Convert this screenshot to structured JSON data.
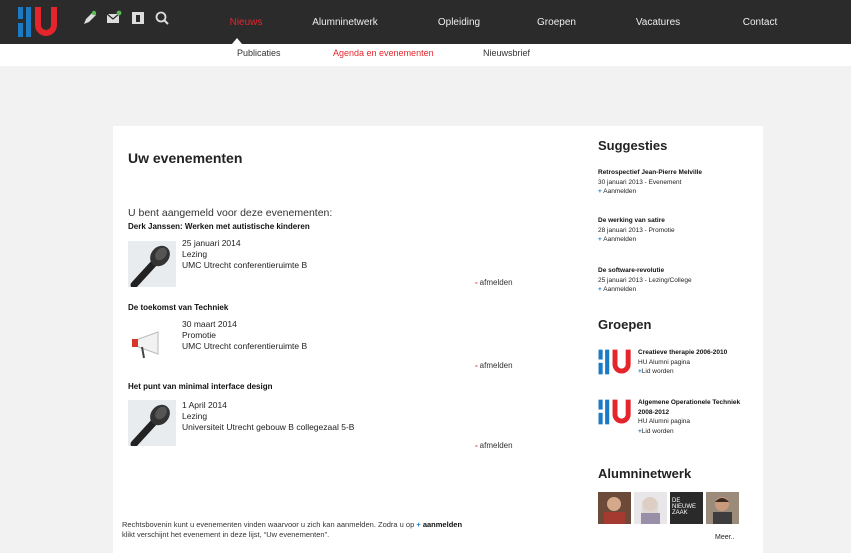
{
  "header": {
    "logo_alt": "HU logo",
    "tools": [
      {
        "icon": "pencil-icon"
      },
      {
        "icon": "mail-icon"
      },
      {
        "icon": "id-card-icon"
      },
      {
        "icon": "search-icon"
      }
    ],
    "nav": [
      {
        "label": "Nieuws",
        "active": true
      },
      {
        "label": "Alumninetwerk",
        "active": false
      },
      {
        "label": "Opleiding",
        "active": false
      },
      {
        "label": "Groepen",
        "active": false
      },
      {
        "label": "Vacatures",
        "active": false
      },
      {
        "label": "Contact",
        "active": false
      }
    ],
    "subnav": [
      {
        "label": "Publicaties",
        "active": false
      },
      {
        "label": "Agenda en evenementen",
        "active": true
      },
      {
        "label": "Nieuwsbrief",
        "active": false
      }
    ]
  },
  "main": {
    "title": "Uw evenementen",
    "intro": "U bent aangemeld voor deze evenementen:",
    "events": [
      {
        "title": "Derk Janssen: Werken met autistische kinderen",
        "date": "25 januari 2014",
        "type": "Lezing",
        "location": "UMC Utrecht conferentieruimte B",
        "action": "afmelden",
        "thumb": "microphone"
      },
      {
        "title": "De toekomst van Techniek",
        "date": "30 maart 2014",
        "type": "Promotie",
        "location": "UMC Utrecht conferentieruimte B",
        "action": "afmelden",
        "thumb": "megaphone"
      },
      {
        "title": "Het punt van minimal interface design",
        "date": "1 April 2014",
        "type": "Lezing",
        "location": "Universiteit Utrecht gebouw B collegezaal 5-B",
        "action": "afmelden",
        "thumb": "microphone"
      }
    ],
    "footnote_part1": "Rechtsbovenin kunt u evenementen vinden waarvoor u zich kan aanmelden. Zodra u op",
    "footnote_plus": "+",
    "footnote_bold": "aanmelden",
    "footnote_part2": "klikt verschijnt het evenement in deze lijst, “Uw evenementen”."
  },
  "sidebar": {
    "suggesties_title": "Suggesties",
    "suggesties": [
      {
        "title": "Retrospectief Jean-Pierre Melville",
        "info": "30 januari 2013 - Evenement",
        "action": "Aanmelden"
      },
      {
        "title": "De werking van satire",
        "info": "28 januari 2013 - Promotie",
        "action": "Aanmelden"
      },
      {
        "title": "De software-revolutie",
        "info": "25 januari 2013 - Lezing/College",
        "action": "Aanmelden"
      }
    ],
    "groepen_title": "Groepen",
    "groepen": [
      {
        "title": "Creatieve therapie  2006-2010",
        "sub": "HU Alumni pagina",
        "action": "Lid worden"
      },
      {
        "title": "Algemene Operationele Techniek 2008-2012",
        "sub": "HU Alumni pagina",
        "action": "Lid worden"
      }
    ],
    "alumni_title": "Alumninetwerk",
    "alumni_photos": [
      "person-photo-1",
      "person-photo-2",
      "de-nieuwe-zaak-photo",
      "person-photo-3"
    ],
    "alumni_badge": "DE NIEUWE ZAAK",
    "meer": "Meer.."
  },
  "colors": {
    "accent_red": "#e4262c",
    "accent_blue": "#1a7ac4",
    "topbar": "#2b2b2b",
    "background": "#f2f2f2"
  }
}
